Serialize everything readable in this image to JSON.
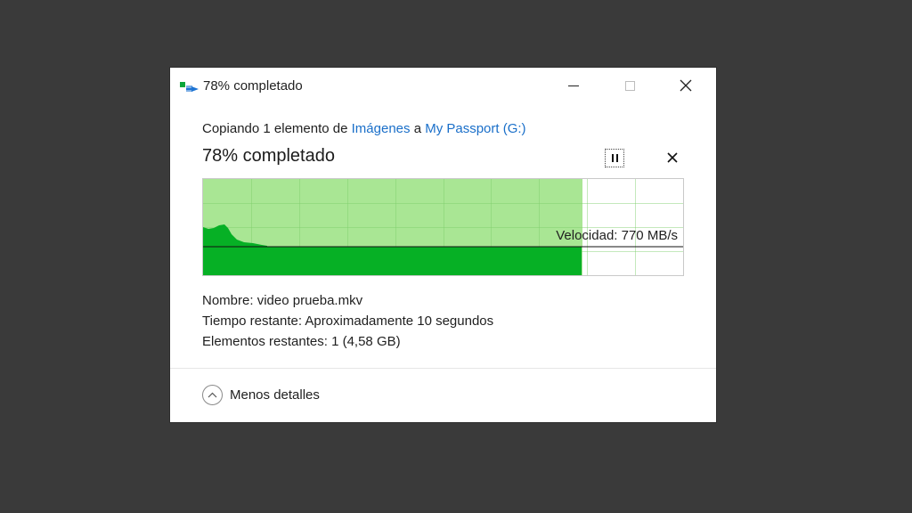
{
  "window": {
    "title": "78% completado",
    "icon": "file-copy-icon",
    "controls": {
      "minimize": "minimize-icon",
      "maximize": "maximize-icon",
      "close": "close-icon"
    }
  },
  "copy": {
    "prefix": "Copiando 1 elemento de",
    "source": "Imágenes",
    "connector": "a",
    "destination": "My Passport (G:)"
  },
  "status": {
    "heading": "78% completado",
    "progress_percent": 78,
    "speed_label": "Velocidad: 770 MB/s",
    "pause_icon": "pause-icon",
    "cancel_icon": "close-icon"
  },
  "colors": {
    "progress_fill": "#a9e694",
    "throughput_fill": "#06b025",
    "link": "#1a6fc9"
  },
  "details": {
    "name_label": "Nombre:",
    "name_value": "video prueba.mkv",
    "time_label": "Tiempo restante:",
    "time_value": "Aproximadamente 10 segundos",
    "items_label": "Elementos restantes:",
    "items_value": "1 (4,58 GB)"
  },
  "footer": {
    "toggle_label": "Menos detalles",
    "toggle_icon": "chevron-up-icon"
  }
}
